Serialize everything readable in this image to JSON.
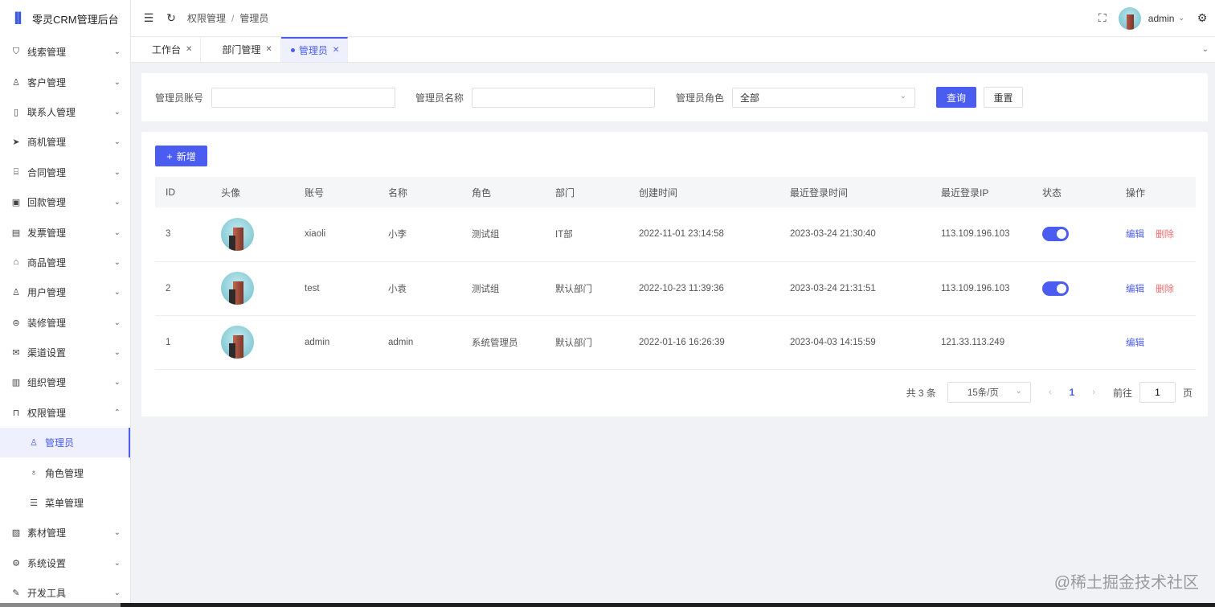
{
  "brand": {
    "logo": "ll",
    "title": "零灵CRM管理后台"
  },
  "sidebar": {
    "items": [
      {
        "label": "线索管理",
        "icon": "clue-icon",
        "glyph": "⛉",
        "arrow": "⌄"
      },
      {
        "label": "客户管理",
        "icon": "user-icon",
        "glyph": "♙",
        "arrow": "⌄"
      },
      {
        "label": "联系人管理",
        "icon": "contact-icon",
        "glyph": "▯",
        "arrow": "⌄"
      },
      {
        "label": "商机管理",
        "icon": "send-icon",
        "glyph": "➤",
        "arrow": "⌄"
      },
      {
        "label": "合同管理",
        "icon": "briefcase-icon",
        "glyph": "⌸",
        "arrow": "⌄"
      },
      {
        "label": "回款管理",
        "icon": "money-icon",
        "glyph": "▣",
        "arrow": "⌄"
      },
      {
        "label": "发票管理",
        "icon": "invoice-icon",
        "glyph": "▤",
        "arrow": "⌄"
      },
      {
        "label": "商品管理",
        "icon": "bag-icon",
        "glyph": "⌂",
        "arrow": "⌄"
      },
      {
        "label": "用户管理",
        "icon": "user-icon",
        "glyph": "♙",
        "arrow": "⌄"
      },
      {
        "label": "装修管理",
        "icon": "decor-icon",
        "glyph": "⊜",
        "arrow": "⌄"
      },
      {
        "label": "渠道设置",
        "icon": "mail-icon",
        "glyph": "✉",
        "arrow": "⌄"
      },
      {
        "label": "组织管理",
        "icon": "org-icon",
        "glyph": "▥",
        "arrow": "⌄"
      },
      {
        "label": "权限管理",
        "icon": "lock-icon",
        "glyph": "⊓",
        "arrow": "⌃"
      }
    ],
    "subitems": [
      {
        "label": "管理员",
        "icon": "user-icon",
        "glyph": "♙"
      },
      {
        "label": "角色管理",
        "icon": "bulb-icon",
        "glyph": "♁"
      },
      {
        "label": "菜单管理",
        "icon": "menu-icon",
        "glyph": "☰"
      }
    ],
    "bottom_items": [
      {
        "label": "素材管理",
        "icon": "picture-icon",
        "glyph": "▨",
        "arrow": "⌄"
      },
      {
        "label": "系统设置",
        "icon": "gear-icon",
        "glyph": "⚙",
        "arrow": "⌄"
      },
      {
        "label": "开发工具",
        "icon": "edit-icon",
        "glyph": "✎",
        "arrow": "⌄"
      }
    ]
  },
  "header": {
    "fold_icon": "☰",
    "refresh_icon": "↻",
    "breadcrumb": [
      "权限管理",
      "管理员"
    ],
    "breadcrumb_sep": "/",
    "fullscreen_icon": "⛶",
    "user_name": "admin",
    "user_arrow": "⌄",
    "gear_icon": "⚙"
  },
  "tabs": [
    {
      "label": "工作台",
      "close": "✕"
    },
    {
      "label": "部门管理",
      "close": "✕"
    },
    {
      "label": "管理员",
      "close": "✕"
    }
  ],
  "tabs_more": "⌄",
  "search": {
    "account_label": "管理员账号",
    "account_value": "",
    "name_label": "管理员名称",
    "name_value": "",
    "role_label": "管理员角色",
    "role_value": "全部",
    "role_caret": "⌄",
    "query_button": "查询",
    "reset_button": "重置"
  },
  "table": {
    "add_button": "新增",
    "add_plus": "+",
    "columns": [
      "ID",
      "头像",
      "账号",
      "名称",
      "角色",
      "部门",
      "创建时间",
      "最近登录时间",
      "最近登录IP",
      "状态",
      "操作"
    ],
    "rows": [
      {
        "id": "3",
        "account": "xiaoli",
        "name": "小李",
        "role": "测试组",
        "dept": "IT部",
        "created": "2022-11-01 23:14:58",
        "last_login": "2023-03-24 21:30:40",
        "ip": "113.109.196.103",
        "status_on": true,
        "edit": "编辑",
        "delete": "删除"
      },
      {
        "id": "2",
        "account": "test",
        "name": "小袁",
        "role": "测试组",
        "dept": "默认部门",
        "created": "2022-10-23 11:39:36",
        "last_login": "2023-03-24 21:31:51",
        "ip": "113.109.196.103",
        "status_on": true,
        "edit": "编辑",
        "delete": "删除"
      },
      {
        "id": "1",
        "account": "admin",
        "name": "admin",
        "role": "系统管理员",
        "dept": "默认部门",
        "created": "2022-01-16 16:26:39",
        "last_login": "2023-04-03 14:15:59",
        "ip": "121.33.113.249",
        "status_on": false,
        "edit": "编辑",
        "delete": ""
      }
    ]
  },
  "pagination": {
    "total": "共 3 条",
    "page_size": "15条/页",
    "size_caret": "⌄",
    "prev": "‹",
    "current": "1",
    "next": "›",
    "goto_label": "前往",
    "goto_value": "1",
    "page_suffix": "页"
  },
  "watermark": "@稀土掘金技术社区",
  "colors": {
    "accent": "#4b5cf0",
    "danger": "#f56c6c",
    "background": "#f0f2f5"
  }
}
